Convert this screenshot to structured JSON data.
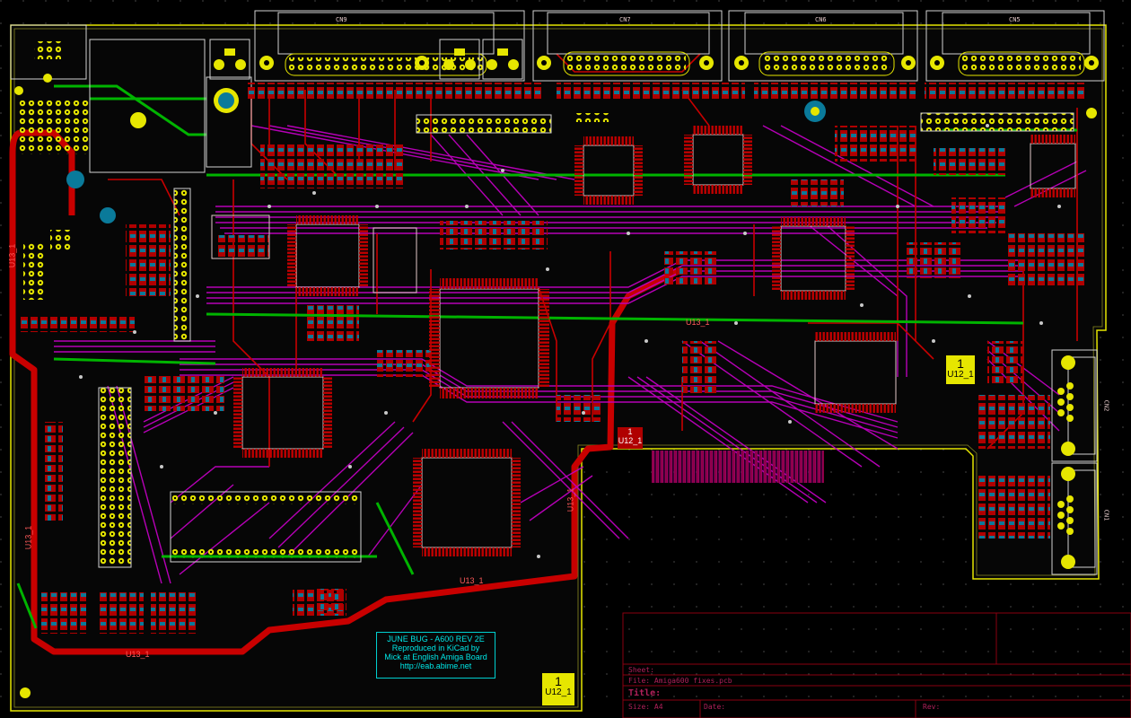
{
  "board": {
    "credit_lines": [
      "JUNE BUG - A600 REV 2E",
      "Reproduced in KiCad by",
      "Mick at English Amiga Board",
      "http://eab.abime.net"
    ]
  },
  "connectors": {
    "cn9": "CN9",
    "cn7": "CN7",
    "cn6": "CN6",
    "cn5": "CN5",
    "cn2": "CN2",
    "cn1": "CN1"
  },
  "zone_labels": {
    "u13_left": "U13_1",
    "u13_mid": "U13_1",
    "u13_lower_left": "U13_1",
    "u13_bottom": "U13_1",
    "u13_cutout_bottom": "U13_1",
    "u13_cutout_side": "U13_1"
  },
  "mount_pads": {
    "pad_right": {
      "num": "1",
      "ref": "U12_1"
    },
    "pad_bottom": {
      "num": "1",
      "ref": "U12_1"
    },
    "pad_mid": {
      "num": "1",
      "ref": "U12_1"
    }
  },
  "title_block": {
    "sheet": "Sheet:",
    "file": "File: Amiga600 fixes.pcb",
    "title": "Title:",
    "size": "Size: A4",
    "date": "Date:",
    "rev": "Rev:"
  },
  "colors": {
    "background": "#000000",
    "front_copper": "#c80000",
    "back_copper": "#c000c0",
    "ground_trace": "#00b400",
    "silkscreen": "#d2d2d2",
    "edge_cuts": "#e6e600",
    "pads": "#e6e600",
    "vias": "#c8c8c8",
    "comment_text": "#00d0d0"
  }
}
